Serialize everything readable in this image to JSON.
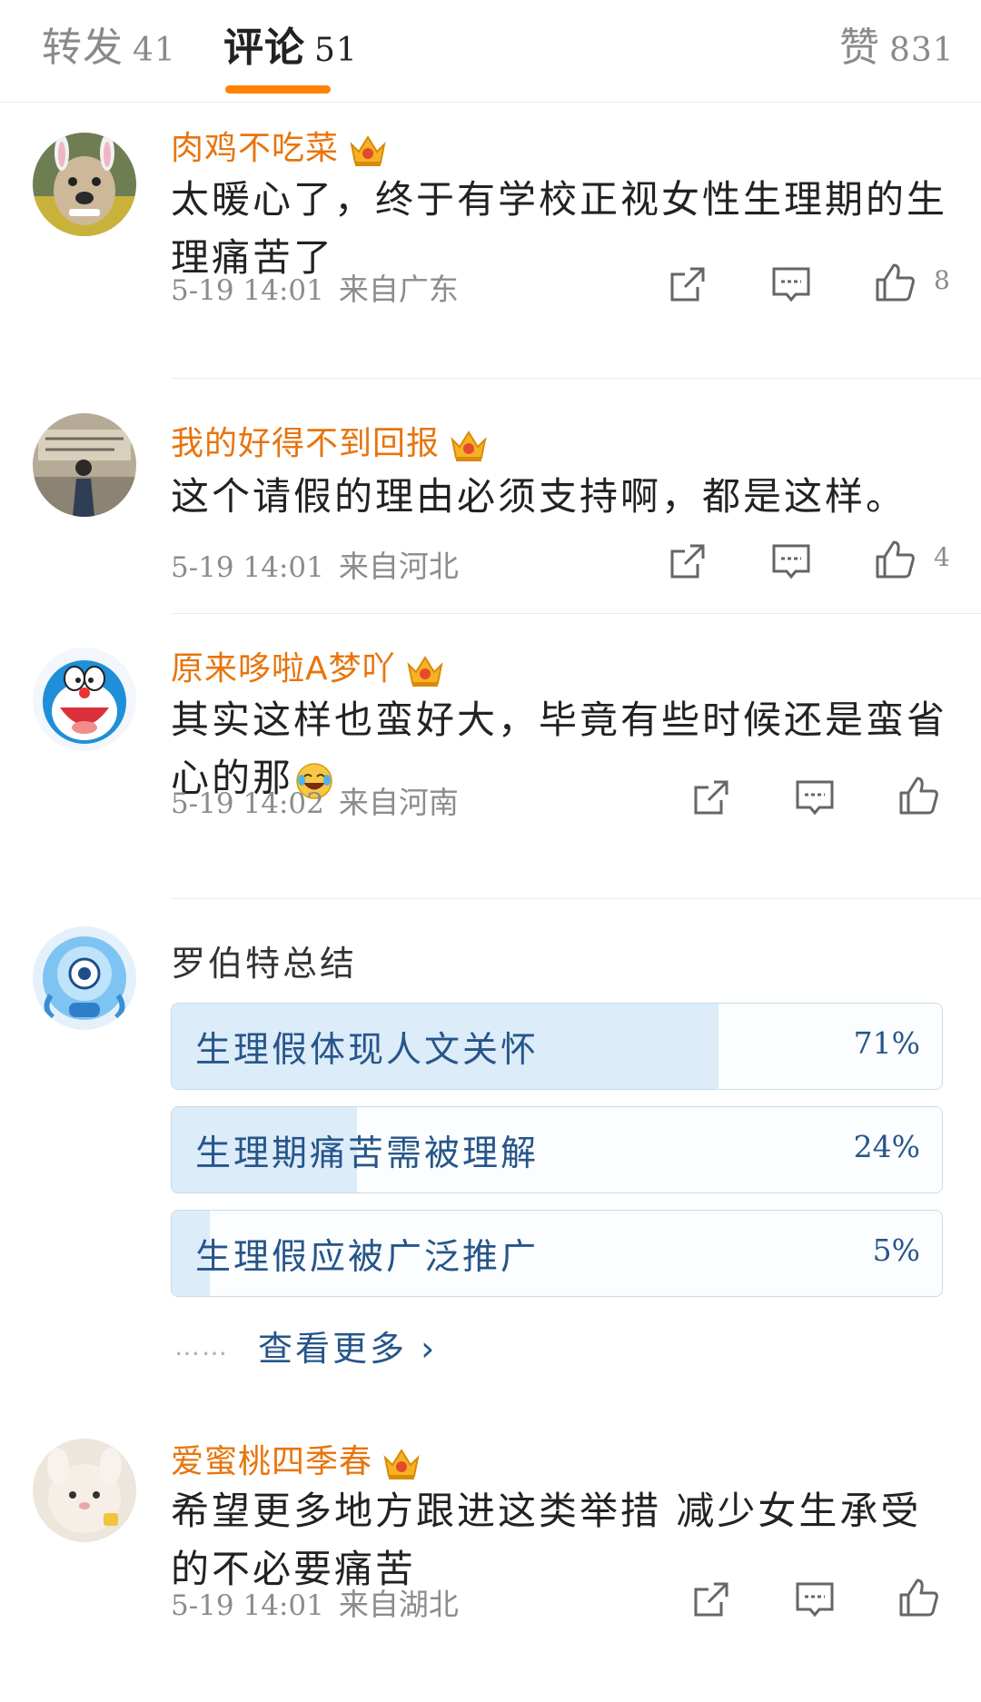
{
  "tabs": [
    {
      "label": "转发",
      "count": "41"
    },
    {
      "label": "评论",
      "count": "51"
    },
    {
      "label": "赞",
      "count": "831"
    }
  ],
  "comments": [
    {
      "username": "肉鸡不吃菜",
      "text": "太暖心了，终于有学校正视女性生理期的生理痛苦了",
      "time": "5-19 14:01",
      "location": "来自广东",
      "likes": "8"
    },
    {
      "username": "我的好得不到回报",
      "text": "这个请假的理由必须支持啊，都是这样。",
      "time": "5-19 14:01",
      "location": "来自河北",
      "likes": "4"
    },
    {
      "username": "原来哆啦A梦吖",
      "text": "其实这样也蛮好大，毕竟有些时候还是蛮省心的那",
      "time": "5-19 14:02",
      "location": "来自河南",
      "likes": ""
    },
    {
      "username": "爱蜜桃四季春",
      "text": "希望更多地方跟进这类举措 减少女生承受的不必要痛苦",
      "time": "5-19 14:01",
      "location": "来自湖北",
      "likes": ""
    }
  ],
  "poll": {
    "title": "罗伯特总结",
    "options": [
      {
        "label": "生理假体现人文关怀",
        "percent": "71%",
        "value": 0.71
      },
      {
        "label": "生理期痛苦需被理解",
        "percent": "24%",
        "value": 0.24
      },
      {
        "label": "生理假应被广泛推广",
        "percent": "5%",
        "value": 0.05
      }
    ],
    "more_dots": "……",
    "more_label": "查看更多 ›"
  },
  "colors": {
    "accent": "#ff8200",
    "username": "#e8740c",
    "poll_text": "#26558a",
    "poll_fill": "#dcecf8"
  },
  "icons": {
    "vip": "crown-badge-icon",
    "emoji": "laugh-cry-emoji-icon",
    "repost": "repost-icon",
    "reply": "comment-icon",
    "like": "thumbs-up-icon"
  }
}
